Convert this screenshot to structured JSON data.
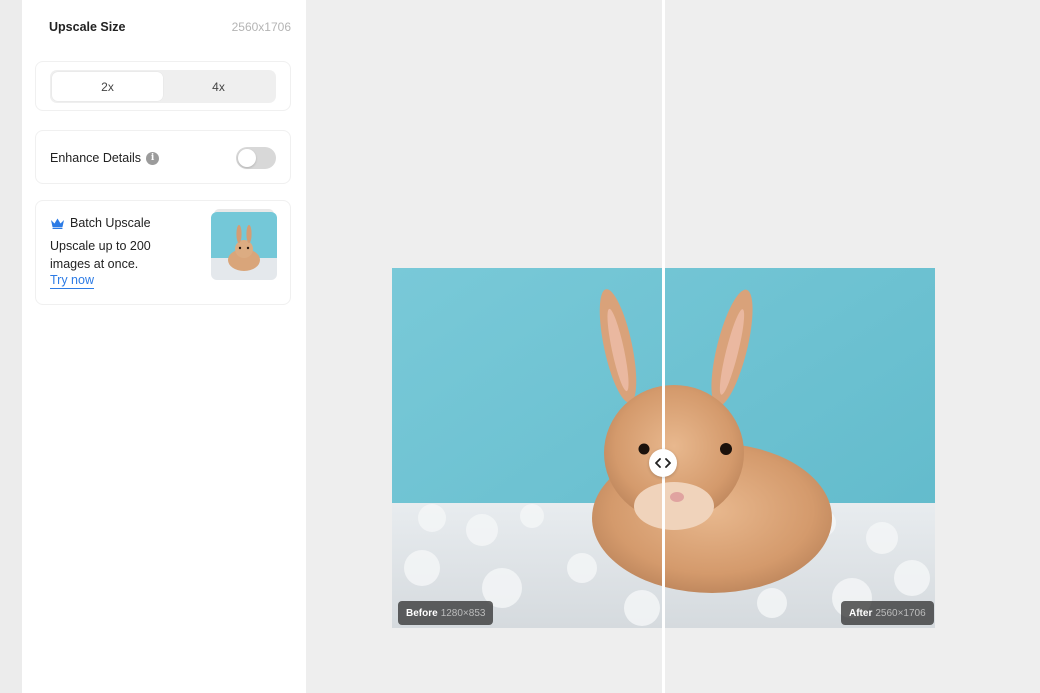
{
  "sidebar": {
    "upscale_size_label": "Upscale Size",
    "upscale_size_value": "2560x1706",
    "scale_options": [
      {
        "label": "2x",
        "selected": true
      },
      {
        "label": "4x",
        "selected": false
      }
    ],
    "enhance_details_label": "Enhance Details",
    "enhance_details_enabled": false,
    "batch": {
      "title": "Batch Upscale",
      "description": "Upscale up to 200 images at once.",
      "link": "Try now"
    }
  },
  "preview": {
    "before_label": "Before",
    "before_dims": "1280×853",
    "after_label": "After",
    "after_dims": "2560×1706",
    "slider_fraction": 0.5
  },
  "colors": {
    "accent": "#2c7be5",
    "toggle_off": "#d8d8d8"
  }
}
